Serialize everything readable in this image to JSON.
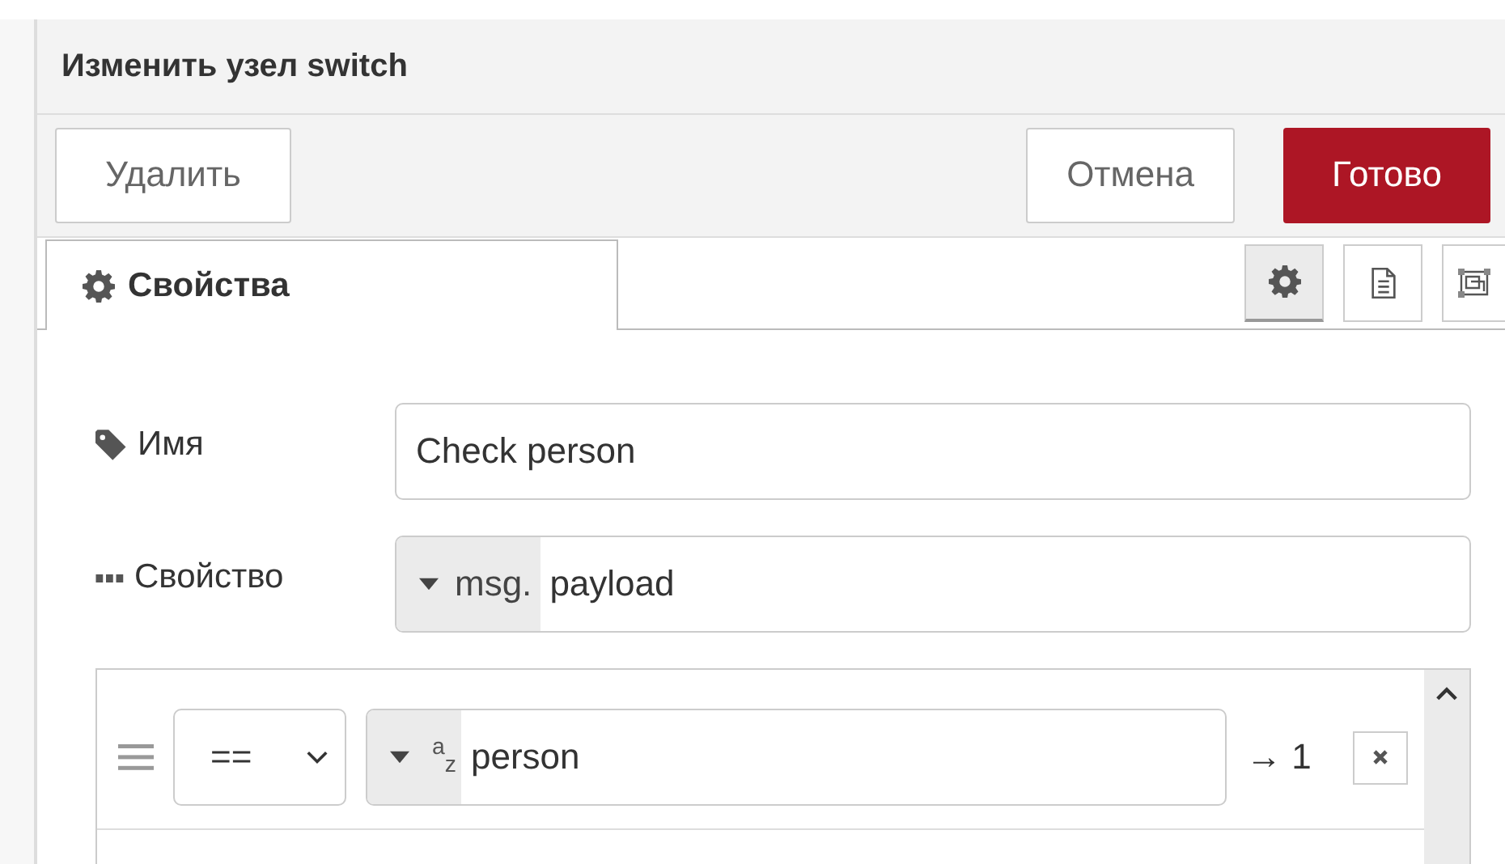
{
  "window": {
    "title": "Изменить узел switch"
  },
  "toolbar": {
    "delete": "Удалить",
    "cancel": "Отмена",
    "done": "Готово"
  },
  "tabs": [
    {
      "label": "Свойства",
      "selected": true
    }
  ],
  "side_buttons": [
    {
      "kind": "gear",
      "selected": true
    },
    {
      "kind": "doc",
      "selected": false
    },
    {
      "kind": "frame",
      "selected": false
    }
  ],
  "fields": [
    {
      "kind": "text",
      "label": "Имя",
      "value": "Check person"
    },
    {
      "kind": "typed",
      "label": "Свойство",
      "prefix": "msg.",
      "value": "payload"
    }
  ],
  "rules": [
    {
      "operator": "==",
      "type_icon": "$^{a}$$_{z}$",
      "value": "person",
      "output": "→ 1"
    }
  ]
}
